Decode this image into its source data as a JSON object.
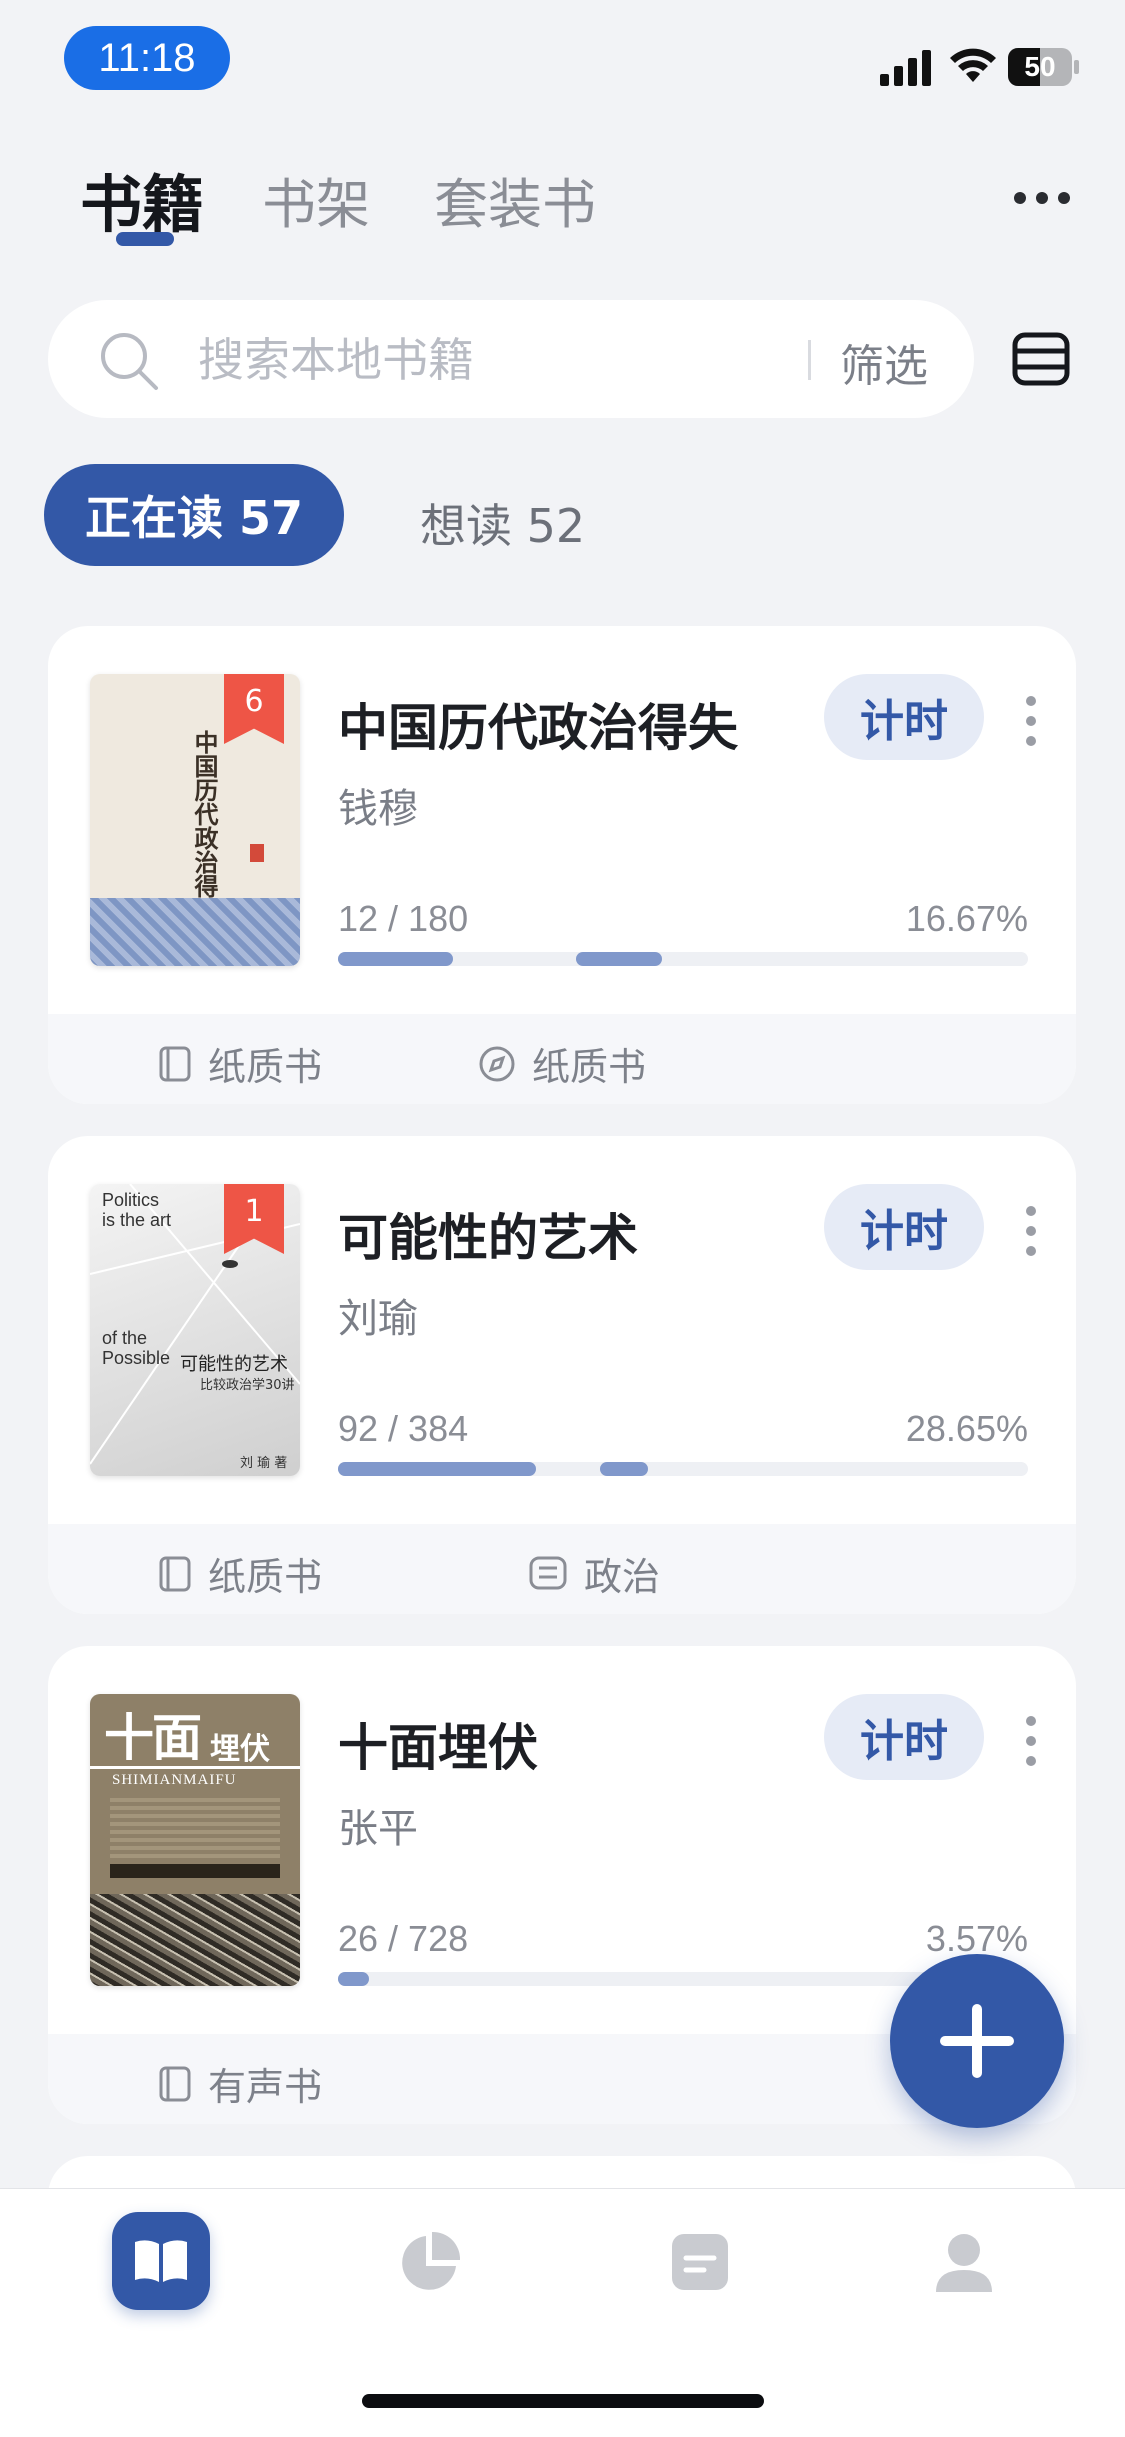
{
  "status_bar": {
    "time": "11:18",
    "battery": "50",
    "battery_level": 0.5
  },
  "header": {
    "tabs": [
      {
        "label": "书籍",
        "active": true
      },
      {
        "label": "书架",
        "active": false
      },
      {
        "label": "套装书",
        "active": false
      }
    ],
    "more_icon": "more-horizontal-icon"
  },
  "search": {
    "placeholder": "搜索本地书籍",
    "filter_label": "筛选"
  },
  "segments": [
    {
      "label": "正在读 57",
      "active": true
    },
    {
      "label": "想读 52",
      "active": false
    }
  ],
  "books": [
    {
      "title": "中国历代政治得失",
      "author": "钱穆",
      "badge": "6",
      "timer_label": "计时",
      "pages": "12 / 180",
      "percent": "16.67%",
      "progress": 0.1667,
      "cover_title": "中国历代政治得失",
      "tags": [
        {
          "icon": "book-icon",
          "label": "纸质书"
        },
        {
          "icon": "compass-icon",
          "label": "纸质书"
        }
      ]
    },
    {
      "title": "可能性的艺术",
      "author": "刘瑜",
      "badge": "1",
      "timer_label": "计时",
      "pages": "92 / 384",
      "percent": "28.65%",
      "progress": 0.2865,
      "cover_lines": [
        "Politics",
        "is the art",
        "of the",
        "Possible",
        "可能性的艺术",
        "比较政治学30讲",
        "刘 瑜 著"
      ],
      "tags": [
        {
          "icon": "book-icon",
          "label": "纸质书"
        },
        {
          "icon": "category-icon",
          "label": "政治"
        }
      ]
    },
    {
      "title": "十面埋伏",
      "author": "张平",
      "timer_label": "计时",
      "pages": "26 / 728",
      "percent": "3.57%",
      "progress": 0.0357,
      "cover_lines": [
        "十面",
        "埋伏",
        "SHIMIANMAIFU"
      ],
      "tags": [
        {
          "icon": "book-icon",
          "label": "有声书"
        }
      ]
    }
  ],
  "fab_icon": "plus-icon",
  "bottom_nav": [
    {
      "icon": "open-book-icon",
      "active": true
    },
    {
      "icon": "pie-chart-icon",
      "active": false
    },
    {
      "icon": "note-icon",
      "active": false
    },
    {
      "icon": "user-icon",
      "active": false
    }
  ]
}
